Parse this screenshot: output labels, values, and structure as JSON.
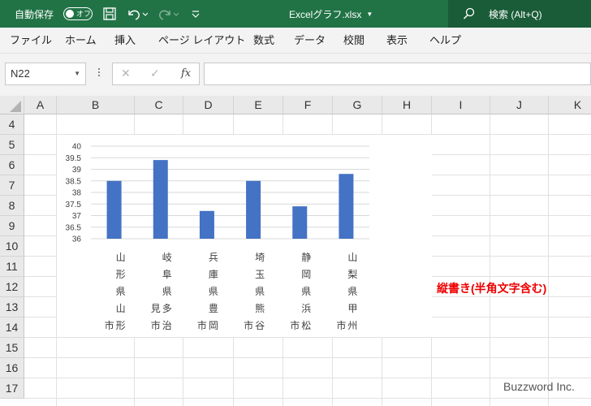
{
  "titlebar": {
    "autosave_label": "自動保存",
    "autosave_state": "オフ",
    "file_name": "Excelグラフ.xlsx",
    "search_label": "検索 (Alt+Q)"
  },
  "ribbon": {
    "tabs": [
      "ファイル",
      "ホーム",
      "挿入",
      "ページ レイアウト",
      "数式",
      "データ",
      "校閲",
      "表示",
      "ヘルプ"
    ]
  },
  "formula_bar": {
    "name_box": "N22",
    "fx": "fx",
    "value": ""
  },
  "grid": {
    "columns": [
      "A",
      "B",
      "C",
      "D",
      "E",
      "F",
      "G",
      "H",
      "I",
      "J",
      "K"
    ],
    "rows": [
      "4",
      "5",
      "6",
      "7",
      "8",
      "9",
      "10",
      "11",
      "12",
      "13",
      "14",
      "15",
      "16",
      "17"
    ]
  },
  "annotation": "縦書き(半角文字含む)",
  "watermark": "Buzzword Inc.",
  "chart_data": {
    "type": "bar",
    "categories": [
      "山形県山形市",
      "岐阜県多治見市",
      "兵庫県豊岡市",
      "埼玉県熊谷市",
      "静岡県浜松市",
      "山梨県甲州市"
    ],
    "values": [
      38.5,
      39.4,
      37.2,
      38.5,
      37.4,
      38.8
    ],
    "ylim": [
      36,
      40
    ],
    "yticks": [
      "40",
      "39.5",
      "39",
      "38.5",
      "38",
      "37.5",
      "37",
      "36.5",
      "36"
    ],
    "color": "#4472c4",
    "grid": true
  }
}
